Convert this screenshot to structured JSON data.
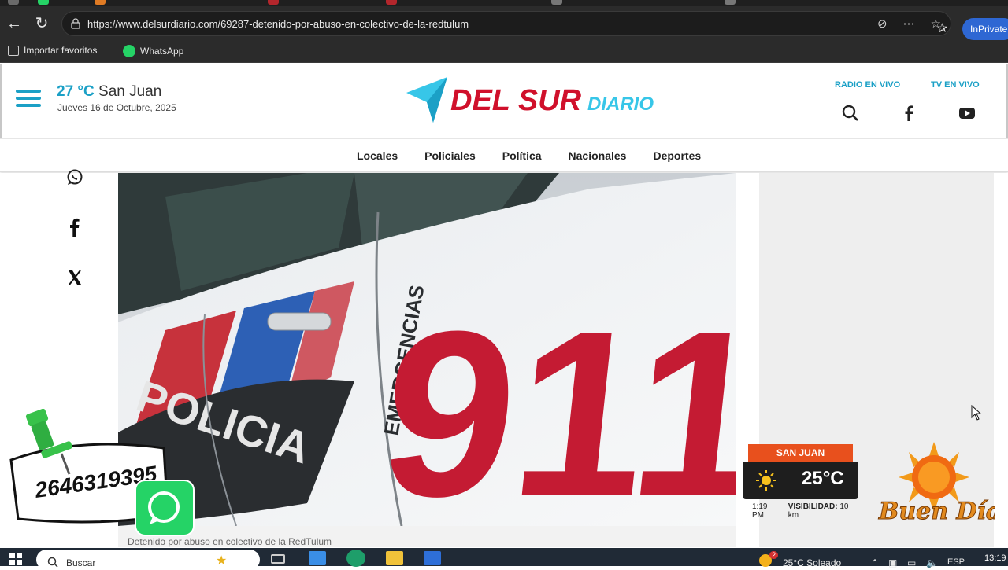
{
  "browser": {
    "url": "https://www.delsurdiario.com/69287-detenido-por-abuso-en-colectivo-de-la-redtulum",
    "inprivate_label": "InPrivate",
    "bookmarks": [
      {
        "label": "Importar favoritos",
        "icon": "import-favorites-icon"
      },
      {
        "label": "WhatsApp",
        "icon": "whatsapp-icon"
      }
    ]
  },
  "header": {
    "temperature": "27 °C",
    "city": "San Juan",
    "date": "Jueves 16 de Octubre, 2025",
    "logo_main": "DEL SUR",
    "logo_sub": "DIARIO",
    "radio_label": "RADIO EN VIVO",
    "tv_label": "TV EN VIVO"
  },
  "menu": {
    "items": [
      "Locales",
      "Policiales",
      "Política",
      "Nacionales",
      "Deportes"
    ]
  },
  "article": {
    "photo_texts": {
      "vehicle_label": "POLICIA",
      "emergency_label": "EMERGENCIAS",
      "number": "911"
    },
    "caption": "Detenido por abuso en colectivo de la RedTulum"
  },
  "phone_widget": {
    "number": "2646319395"
  },
  "weather_widget": {
    "city": "SAN JUAN",
    "temperature": "25°C",
    "time": "1:19 PM",
    "visibility_label": "VISIBILIDAD:",
    "visibility_value": "10 km"
  },
  "buen_dia": {
    "text": "Buen Día"
  },
  "taskbar": {
    "search_placeholder": "Buscar",
    "weather": "25°C  Soleado",
    "language": "ESP",
    "time": "13:19",
    "notification_count": "2"
  },
  "colors": {
    "accent": "#1ba0c6",
    "brand_red": "#d0102b",
    "weather_orange": "#e8501d"
  }
}
